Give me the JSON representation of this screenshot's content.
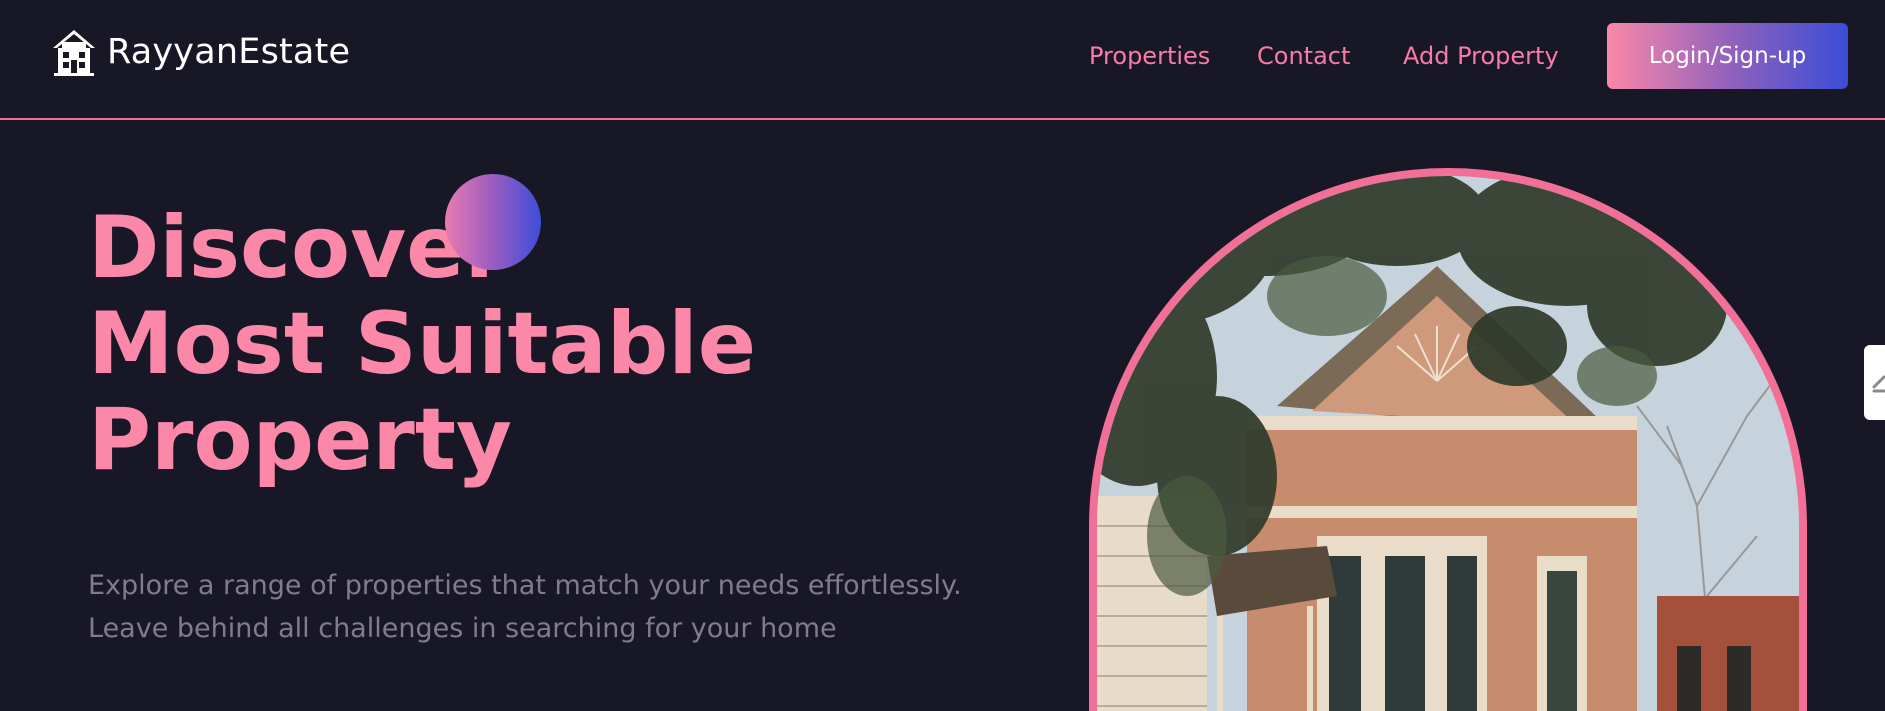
{
  "brand": {
    "name": "RayyanEstate",
    "icon": "house-icon"
  },
  "nav": {
    "links": [
      {
        "label": "Properties"
      },
      {
        "label": "Contact"
      },
      {
        "label": "Add Property"
      }
    ],
    "login_label": "Login/Sign-up"
  },
  "hero": {
    "title_lines": [
      "Discover",
      "Most Suitable",
      "Property"
    ],
    "subtitle_lines": [
      "Explore a range of properties that match your needs effortlessly.",
      "Leave behind all challenges in searching for your home"
    ],
    "image_icon": "house-photo"
  },
  "side_tab": {
    "icon": "slider-handle-icon"
  },
  "colors": {
    "background": "#181726",
    "accent_pink": "#fb88a8",
    "nav_link": "#f77ba5",
    "divider": "#f26f97",
    "gradient_end": "#3a4ed6",
    "subtitle": "#7f7c8e"
  }
}
